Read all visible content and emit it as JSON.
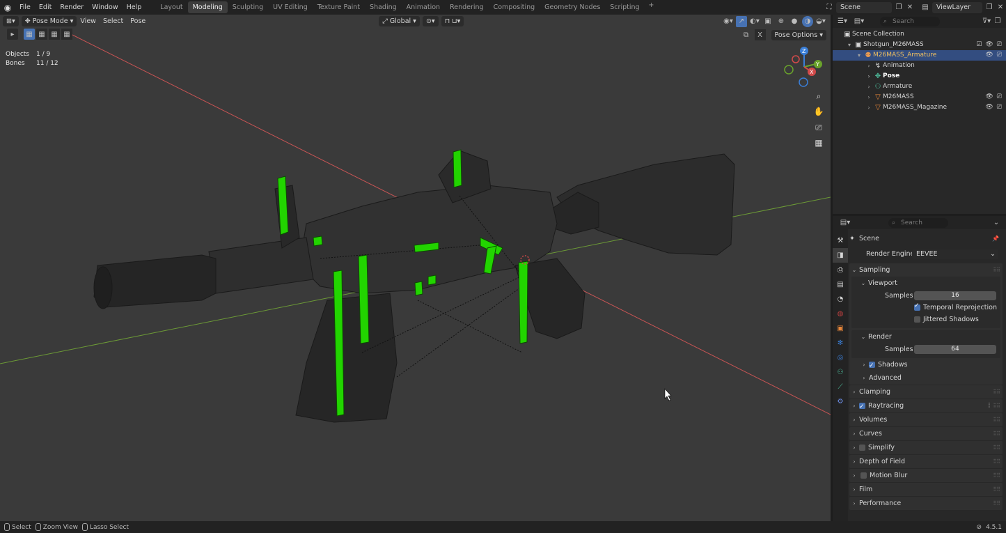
{
  "topbar": {
    "menus": [
      "File",
      "Edit",
      "Render",
      "Window",
      "Help"
    ],
    "workspaces": [
      "Layout",
      "Modeling",
      "Sculpting",
      "UV Editing",
      "Texture Paint",
      "Shading",
      "Animation",
      "Rendering",
      "Compositing",
      "Geometry Nodes",
      "Scripting"
    ],
    "active_workspace": "Modeling",
    "add_workspace": "+",
    "scene": "Scene",
    "view_layer": "ViewLayer"
  },
  "viewport": {
    "mode": "Pose Mode",
    "menus": [
      "View",
      "Select",
      "Pose"
    ],
    "orientation": "Global",
    "pose_options": "Pose Options",
    "stats": [
      {
        "label": "Objects",
        "value": "1 / 9"
      },
      {
        "label": "Bones",
        "value": "11 / 12"
      }
    ],
    "gizmo": {
      "x": "X",
      "y": "Y",
      "z": "Z"
    },
    "side_icons": [
      "zoom-icon",
      "hand-pan-icon",
      "camera-icon",
      "grid-icon"
    ]
  },
  "outliner": {
    "search_placeholder": "Search",
    "items": [
      {
        "label": "Scene Collection",
        "depth": 0,
        "icon": "collection-icon"
      },
      {
        "label": "Shotgun_M26MASS",
        "depth": 1,
        "icon": "collection-icon"
      },
      {
        "label": "M26MASS_Armature",
        "depth": 2,
        "icon": "armature-icon",
        "selected": true
      },
      {
        "label": "Animation",
        "depth": 3,
        "icon": "animation-icon"
      },
      {
        "label": "Pose",
        "depth": 3,
        "icon": "pose-icon"
      },
      {
        "label": "Armature",
        "depth": 3,
        "icon": "armature-data-icon"
      },
      {
        "label": "M26MASS",
        "depth": 3,
        "icon": "mesh-icon"
      },
      {
        "label": "M26MASS_Magazine",
        "depth": 3,
        "icon": "mesh-icon"
      }
    ]
  },
  "properties": {
    "search_placeholder": "Search",
    "context": "Scene",
    "render_engine_label": "Render Engine",
    "render_engine": "EEVEE",
    "sampling": "Sampling",
    "viewport": "Viewport",
    "samples_label": "Samples",
    "viewport_samples": "16",
    "temporal_reprojection": "Temporal Reprojection",
    "jittered_shadows": "Jittered Shadows",
    "render": "Render",
    "render_samples": "64",
    "shadows": "Shadows",
    "advanced": "Advanced",
    "panels": [
      "Clamping",
      "Raytracing",
      "Volumes",
      "Curves",
      "Simplify",
      "Depth of Field",
      "Motion Blur",
      "Film",
      "Performance"
    ]
  },
  "statusbar": {
    "select": "Select",
    "zoom_view": "Zoom View",
    "lasso_select": "Lasso Select",
    "version": "4.5.1"
  },
  "colors": {
    "accent": "#4772b3",
    "selected_row": "#334d80",
    "bone_green": "#22d400",
    "axis_red": "#d24a4a",
    "axis_green": "#6aa32b"
  }
}
